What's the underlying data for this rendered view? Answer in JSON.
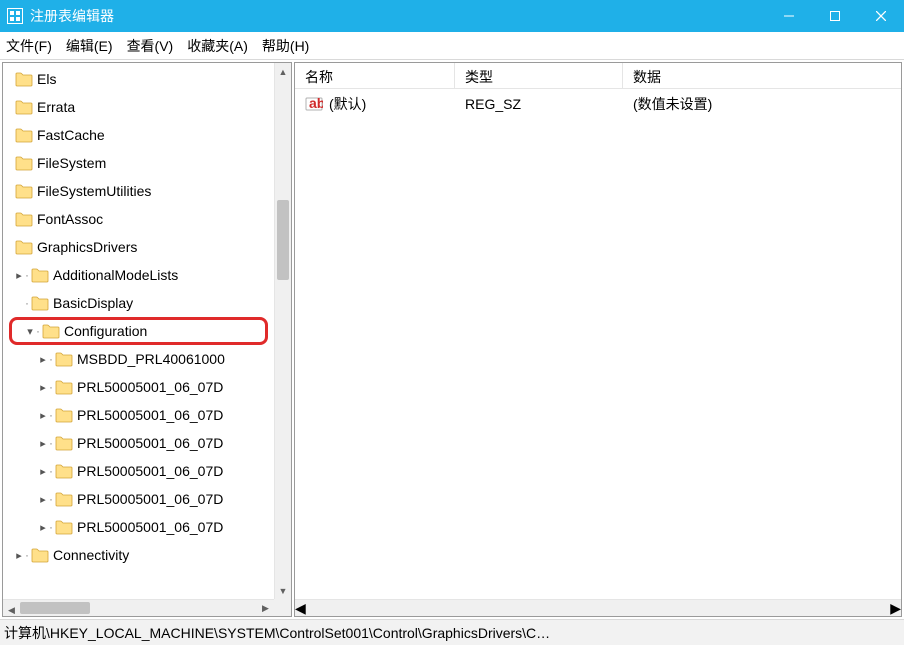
{
  "window": {
    "title": "注册表编辑器"
  },
  "menu": {
    "file": "文件(F)",
    "edit": "编辑(E)",
    "view": "查看(V)",
    "favorites": "收藏夹(A)",
    "help": "帮助(H)"
  },
  "tree": {
    "items": [
      {
        "indent": 0,
        "expander": "",
        "label": "Els"
      },
      {
        "indent": 0,
        "expander": "",
        "label": "Errata"
      },
      {
        "indent": 0,
        "expander": "",
        "label": "FastCache"
      },
      {
        "indent": 0,
        "expander": "",
        "label": "FileSystem"
      },
      {
        "indent": 0,
        "expander": "",
        "label": "FileSystemUtilities"
      },
      {
        "indent": 0,
        "expander": "",
        "label": "FontAssoc"
      },
      {
        "indent": 0,
        "expander": "",
        "label": "GraphicsDrivers"
      },
      {
        "indent": 1,
        "expander": ">",
        "label": "AdditionalModeLists"
      },
      {
        "indent": 1,
        "expander": "",
        "label": "BasicDisplay"
      },
      {
        "indent": 1,
        "expander": "v",
        "label": "Configuration",
        "highlighted": true
      },
      {
        "indent": 2,
        "expander": ">",
        "label": "MSBDD_PRL40061000"
      },
      {
        "indent": 2,
        "expander": ">",
        "label": "PRL50005001_06_07D"
      },
      {
        "indent": 2,
        "expander": ">",
        "label": "PRL50005001_06_07D"
      },
      {
        "indent": 2,
        "expander": ">",
        "label": "PRL50005001_06_07D"
      },
      {
        "indent": 2,
        "expander": ">",
        "label": "PRL50005001_06_07D"
      },
      {
        "indent": 2,
        "expander": ">",
        "label": "PRL50005001_06_07D"
      },
      {
        "indent": 2,
        "expander": ">",
        "label": "PRL50005001_06_07D"
      },
      {
        "indent": 1,
        "expander": ">",
        "label": "Connectivity"
      }
    ]
  },
  "list": {
    "columns": {
      "name": "名称",
      "type": "类型",
      "data": "数据"
    },
    "rows": [
      {
        "name": "(默认)",
        "type": "REG_SZ",
        "data": "(数值未设置)"
      }
    ]
  },
  "statusbar": {
    "path": "计算机\\HKEY_LOCAL_MACHINE\\SYSTEM\\ControlSet001\\Control\\GraphicsDrivers\\C…"
  },
  "icons": {
    "app": "app-grid-icon",
    "folder": "folder-icon",
    "string_value": "string-value-icon",
    "minimize": "minimize-icon",
    "maximize": "maximize-icon",
    "close": "close-icon"
  }
}
